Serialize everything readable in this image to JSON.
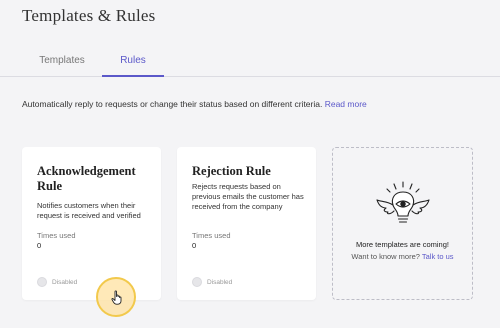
{
  "page": {
    "title": "Templates & Rules"
  },
  "tabs": [
    {
      "label": "Templates",
      "active": false
    },
    {
      "label": "Rules",
      "active": true
    }
  ],
  "description": {
    "text": "Automatically reply to requests or change their status based on different criteria.",
    "link": "Read more"
  },
  "cards": [
    {
      "title": "Acknowledgement Rule",
      "text": "Notifies customers when their request is received and verified",
      "times_used_label": "Times used",
      "times_used": "0",
      "status": "Disabled"
    },
    {
      "title": "Rejection Rule",
      "text": "Rejects requests based on previous emails the customer has received from the company",
      "times_used_label": "Times used",
      "times_used": "0",
      "status": "Disabled"
    }
  ],
  "coming_soon": {
    "icon": "winged-lightbulb-icon",
    "message": "More templates are coming!",
    "question": "Want to know more?",
    "link": "Talk to us"
  },
  "colors": {
    "accent": "#5b58c9",
    "background": "#f4f4f6",
    "card": "#ffffff"
  }
}
